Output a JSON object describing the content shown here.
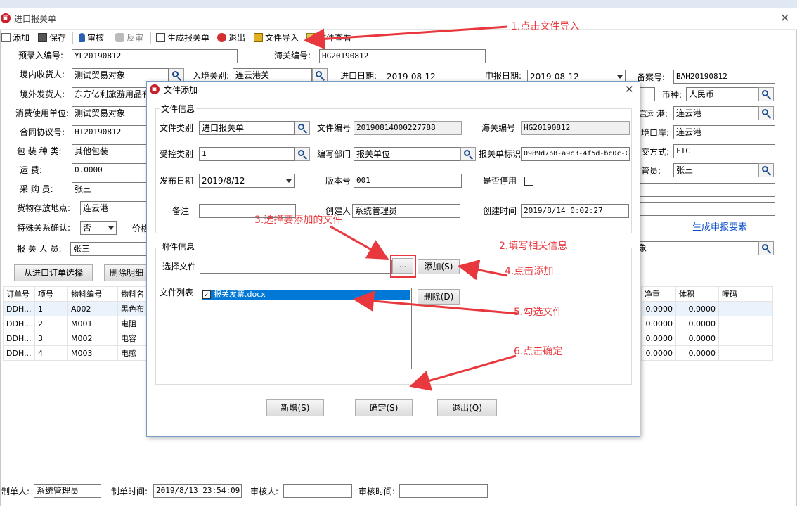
{
  "window": {
    "title": "进口报关单"
  },
  "toolbar": {
    "add": "添加",
    "save": "保存",
    "audit": "审核",
    "unaudit": "反审",
    "gen": "生成报关单",
    "exit": "退出",
    "import": "文件导入",
    "view": "文件查看"
  },
  "form": {
    "pre_entry_label": "预录入编号:",
    "pre_entry": "YL20190812",
    "customs_label": "海关编号:",
    "customs": "HG20190812",
    "consignee_label": "境内收货人:",
    "consignee": "测试贸易对象",
    "entry_type_label": "入境关别:",
    "entry_type": "连云港关",
    "import_date_label": "进口日期:",
    "import_date": "2019-08-12",
    "declare_date_label": "申报日期:",
    "declare_date": "2019-08-12",
    "record_label": "备案号:",
    "record": "BAH20190812",
    "shipper_label": "境外发货人:",
    "shipper": "东方亿利旅游用品有",
    "currency_label": "币种:",
    "currency": "人民币",
    "consumer_label": "消费使用单位:",
    "consumer": "测试贸易对象",
    "port_label": "运 港:",
    "port_prefix": "启",
    "port": "连云港",
    "contract_label": "合同协议号:",
    "contract": "HT20190812",
    "entry_port_label": "境口岸:",
    "entry_port": "连云港",
    "pack_label": "包 装 种 类:",
    "pack": "其他包装",
    "deal_label": "交方式:",
    "deal": "FIC",
    "freight_label": "运 费:",
    "freight": "0.0000",
    "keeper_label": "管员:",
    "keeper": "张三",
    "buyer_label": "采 购 员:",
    "buyer": "张三",
    "store_label": "货物存放地点:",
    "store": "连云港",
    "special_label": "特殊关系确认:",
    "special": "否",
    "price_label": "价格",
    "gen_elements_link": "生成申报要素",
    "declarant_label": "报 关 人 员:",
    "declarant": "张三",
    "obj_tail": "象",
    "from_order_btn": "从进口订单选择",
    "del_detail_btn": "删除明细"
  },
  "grid": {
    "headers": [
      "订单号",
      "项号",
      "物料编号",
      "物料名",
      "净重",
      "体积",
      "唛码"
    ],
    "rows": [
      [
        "DDH...",
        "1",
        "A002",
        "黑色布",
        "0.0000",
        "0.0000"
      ],
      [
        "DDH...",
        "2",
        "M001",
        "电阻",
        "0.0000",
        "0.0000"
      ],
      [
        "DDH...",
        "3",
        "M002",
        "电容",
        "0.0000",
        "0.0000"
      ],
      [
        "DDH...",
        "4",
        "M003",
        "电感",
        "0.0000",
        "0.0000"
      ]
    ]
  },
  "footer": {
    "maker_label": "制单人:",
    "maker": "系统管理员",
    "make_time_label": "制单时间:",
    "make_time": "2019/8/13 23:54:09",
    "auditor_label": "审核人:",
    "auditor": "",
    "audit_time_label": "审核时间:",
    "audit_time": ""
  },
  "dialog": {
    "title": "文件添加",
    "info_group": "文件信息",
    "file_type_label": "文件类别",
    "file_type": "进口报关单",
    "file_no_label": "文件编号",
    "file_no": "20190814000227788",
    "customs_no_label": "海关编号",
    "customs_no": "HG20190812",
    "control_label": "受控类别",
    "control": "1",
    "dept_label": "编写部门",
    "dept": "报关单位",
    "mark_label": "报关单标识",
    "mark": "0989d7b8-a9c3-4f5d-bc0c-C",
    "publish_label": "发布日期",
    "publish": "2019/8/12",
    "version_label": "版本号",
    "version": "001",
    "disabled_label": "是否停用",
    "remark_label": "备注",
    "remark": "",
    "creator_label": "创建人",
    "creator": "系统管理员",
    "created_label": "创建时间",
    "created": "2019/8/14 0:02:27",
    "attach_group": "附件信息",
    "select_label": "选择文件",
    "select_value": "",
    "browse": "...",
    "add_btn": "添加(S)",
    "list_label": "文件列表",
    "list_items": [
      "报关发票.docx"
    ],
    "delete_btn": "删除(D)",
    "new_btn": "新增(S)",
    "ok_btn": "确定(S)",
    "exit_btn": "退出(Q)"
  },
  "annotations": {
    "a1": "1.点击文件导入",
    "a2": "2.填写相关信息",
    "a3": "3.选择要添加的文件",
    "a4": "4.点击添加",
    "a5": "5.勾选文件",
    "a6": "6.点击确定"
  },
  "colors": {
    "accent": "#0078d7",
    "annotation": "#e8383d",
    "link": "#0b4fc9"
  }
}
